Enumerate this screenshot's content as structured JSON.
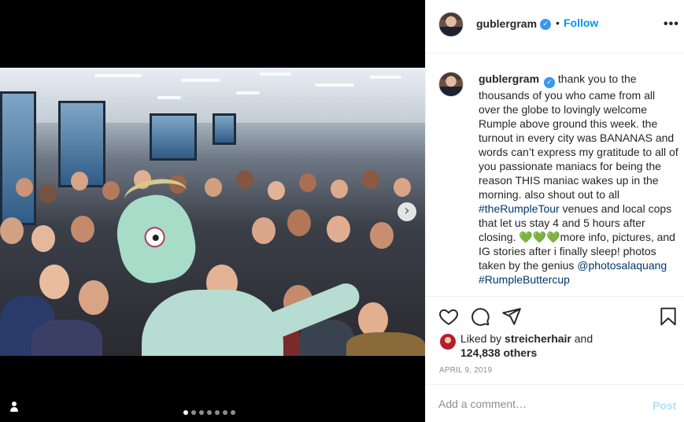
{
  "post": {
    "username": "gublergram",
    "verified_glyph": "✓",
    "separator": "•",
    "follow_label": "Follow",
    "more_label": "•••",
    "caption_username": "gublergram",
    "caption_text_1": "thank you to the thousands of you who came from all over the globe to lovingly welcome Rumple above ground this week. the turnout in every city was BANANAS and words can’t express my gratitude to all of you passionate maniacs for being the reason THIS maniac wakes up in the morning. also shout out to all ",
    "hashtag_1": "#theRumpleTour",
    "caption_text_2": " venues and local cops that let us stay 4 and 5 hours after closing. ",
    "hearts": "💚💚💚",
    "caption_text_3": "more info, pictures, and IG stories after i finally sleep! photos taken by the genius ",
    "mention": "@photosalaquang",
    "hashtag_2": "#RumpleButtercup",
    "liked_by_prefix": "Liked by ",
    "liked_by_user": "streicherhair",
    "liked_by_and": " and",
    "likes_count": "124,838 others",
    "date": "APRIL 9, 2019",
    "comment_placeholder": "Add a comment…",
    "post_label": "Post"
  },
  "media": {
    "next_arrow": "›",
    "carousel_count": 7,
    "carousel_active": 0
  },
  "icons": {
    "like": "heart-icon",
    "comment": "comment-icon",
    "share": "share-icon",
    "save": "bookmark-icon",
    "tag": "user-tag-icon"
  },
  "colors": {
    "link_blue": "#0095f6",
    "hashtag_blue": "#00376b",
    "verified_blue": "#3897f0",
    "post_disabled": "#b2dffc",
    "muted": "#8e8e8e"
  }
}
